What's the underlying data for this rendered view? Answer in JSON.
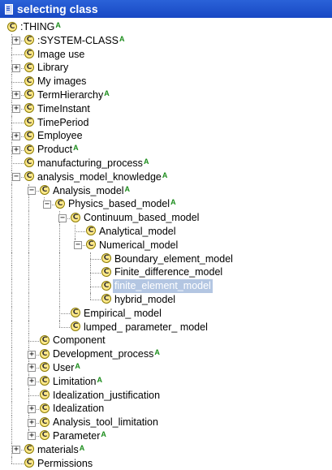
{
  "window": {
    "title": "selecting class"
  },
  "badge_text": "A",
  "class_icon_letter": "C",
  "tree": [
    {
      "label": ":THING",
      "depth": 0,
      "expander": "none",
      "badge": true
    },
    {
      "label": ":SYSTEM-CLASS",
      "depth": 1,
      "expander": "+",
      "badge": true
    },
    {
      "label": "Image use",
      "depth": 1,
      "expander": "none",
      "badge": false
    },
    {
      "label": "Library",
      "depth": 1,
      "expander": "+",
      "badge": false
    },
    {
      "label": "My images",
      "depth": 1,
      "expander": "none",
      "badge": false
    },
    {
      "label": "TermHierarchy",
      "depth": 1,
      "expander": "+",
      "badge": true
    },
    {
      "label": "TimeInstant",
      "depth": 1,
      "expander": "+",
      "badge": false
    },
    {
      "label": "TimePeriod",
      "depth": 1,
      "expander": "none",
      "badge": false
    },
    {
      "label": "Employee",
      "depth": 1,
      "expander": "+",
      "badge": false
    },
    {
      "label": "Product",
      "depth": 1,
      "expander": "+",
      "badge": true
    },
    {
      "label": "manufacturing_process",
      "depth": 1,
      "expander": "none",
      "badge": true
    },
    {
      "label": "analysis_model_knowledge",
      "depth": 1,
      "expander": "-",
      "badge": true
    },
    {
      "label": "Analysis_model",
      "depth": 2,
      "expander": "-",
      "badge": true
    },
    {
      "label": "Physics_based_model",
      "depth": 3,
      "expander": "-",
      "badge": true
    },
    {
      "label": "Continuum_based_model",
      "depth": 4,
      "expander": "-",
      "badge": false
    },
    {
      "label": "Analytical_model",
      "depth": 5,
      "expander": "none",
      "badge": false
    },
    {
      "label": "Numerical_model",
      "depth": 5,
      "expander": "-",
      "badge": false
    },
    {
      "label": "Boundary_element_model",
      "depth": 6,
      "expander": "none",
      "badge": false
    },
    {
      "label": "Finite_difference_model",
      "depth": 6,
      "expander": "none",
      "badge": false
    },
    {
      "label": "finite_element_model",
      "depth": 6,
      "expander": "none",
      "badge": false,
      "selected": true
    },
    {
      "label": "hybrid_model",
      "depth": 6,
      "expander": "none",
      "badge": false
    },
    {
      "label": "Empirical_ model",
      "depth": 4,
      "expander": "none",
      "badge": false
    },
    {
      "label": "lumped_ parameter_ model",
      "depth": 4,
      "expander": "none",
      "badge": false
    },
    {
      "label": "Component",
      "depth": 2,
      "expander": "none",
      "badge": false
    },
    {
      "label": "Development_process",
      "depth": 2,
      "expander": "+",
      "badge": true
    },
    {
      "label": "User",
      "depth": 2,
      "expander": "+",
      "badge": true
    },
    {
      "label": "Limitation",
      "depth": 2,
      "expander": "+",
      "badge": true
    },
    {
      "label": "Idealization_justification",
      "depth": 2,
      "expander": "none",
      "badge": false
    },
    {
      "label": "Idealization",
      "depth": 2,
      "expander": "+",
      "badge": false
    },
    {
      "label": "Analysis_tool_limitation",
      "depth": 2,
      "expander": "+",
      "badge": false
    },
    {
      "label": "Parameter",
      "depth": 2,
      "expander": "+",
      "badge": true
    },
    {
      "label": "materials",
      "depth": 1,
      "expander": "+",
      "badge": true
    },
    {
      "label": "Permissions",
      "depth": 1,
      "expander": "none",
      "badge": false
    }
  ]
}
